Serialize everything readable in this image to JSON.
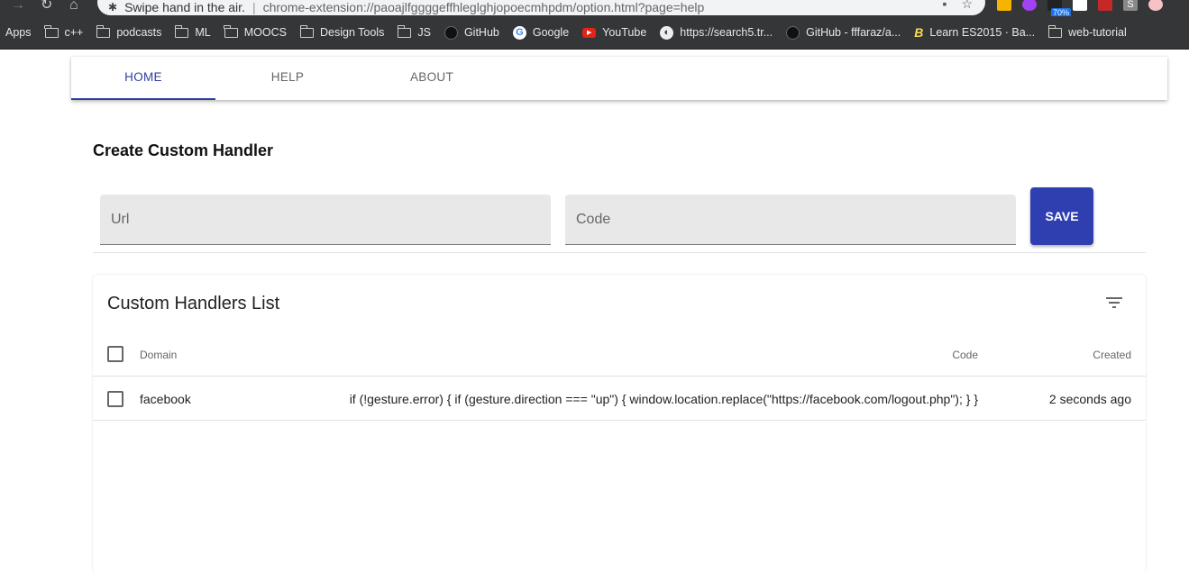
{
  "browser": {
    "tab_title": "Swipe hand in the air.",
    "url": "chrome-extension://paoajlfggggeffhleglghjopoecmhpdm/option.html?page=help",
    "extension_badge": "70%",
    "bookmarks": [
      {
        "label": "Apps",
        "icon": "none"
      },
      {
        "label": "c++",
        "icon": "folder-icon"
      },
      {
        "label": "podcasts",
        "icon": "folder-icon"
      },
      {
        "label": "ML",
        "icon": "folder-icon"
      },
      {
        "label": "MOOCS",
        "icon": "folder-icon"
      },
      {
        "label": "Design Tools",
        "icon": "folder-icon"
      },
      {
        "label": "JS",
        "icon": "folder-icon"
      },
      {
        "label": "GitHub",
        "icon": "github-icon"
      },
      {
        "label": "Google",
        "icon": "google-icon"
      },
      {
        "label": "YouTube",
        "icon": "youtube-icon"
      },
      {
        "label": "https://search5.tr...",
        "icon": "globe-icon"
      },
      {
        "label": "GitHub - fffaraz/a...",
        "icon": "github-icon"
      },
      {
        "label": "Learn ES2015 · Ba...",
        "icon": "babel-icon"
      },
      {
        "label": "web-tutorial",
        "icon": "folder-icon"
      }
    ]
  },
  "nav": {
    "tabs": [
      {
        "label": "HOME",
        "active": true
      },
      {
        "label": "HELP",
        "active": false
      },
      {
        "label": "ABOUT",
        "active": false
      }
    ]
  },
  "form": {
    "title": "Create Custom Handler",
    "url_placeholder": "Url",
    "url_value": "",
    "code_placeholder": "Code",
    "code_value": "",
    "save_label": "SAVE"
  },
  "list": {
    "title": "Custom Handlers List",
    "columns": [
      "Domain",
      "Code",
      "Created"
    ],
    "rows": [
      {
        "domain": "facebook",
        "code": "if (!gesture.error) { if (gesture.direction === \"up\") { window.location.replace(\"https://facebook.com/logout.php\"); } }",
        "created": "2 seconds ago"
      }
    ]
  },
  "colors": {
    "primary": "#303f9f",
    "save_button": "#303fb0",
    "field_bg": "#e8e8e8",
    "chrome_dark": "#353638"
  }
}
